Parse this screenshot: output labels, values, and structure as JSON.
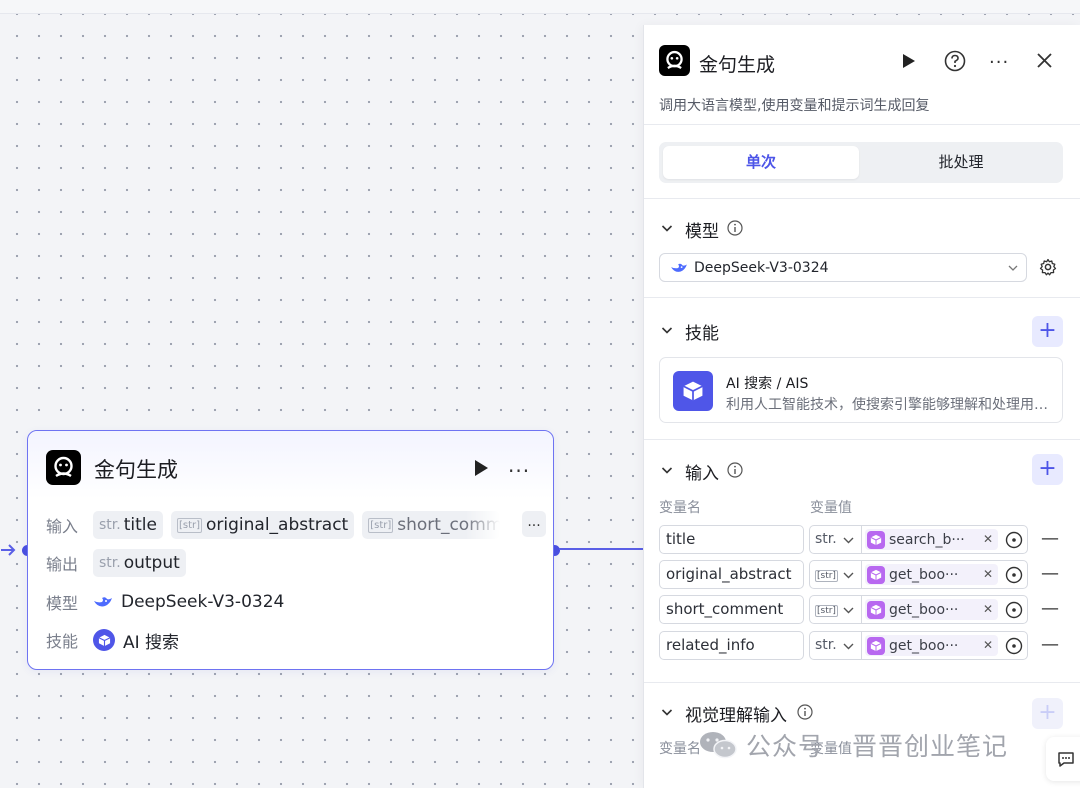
{
  "node": {
    "title": "金句生成",
    "input_label": "输入",
    "output_label": "输出",
    "model_label": "模型",
    "skill_label": "技能",
    "inputs": [
      {
        "type": "str.",
        "name": "title"
      },
      {
        "type": "[str]",
        "name": "original_abstract"
      },
      {
        "type": "[str]",
        "name": "short_comment"
      }
    ],
    "output": {
      "type": "str.",
      "name": "output"
    },
    "model": "DeepSeek-V3-0324",
    "skill": "AI 搜索",
    "more": "..."
  },
  "panel": {
    "title": "金句生成",
    "description": "调用大语言模型,使用变量和提示词生成回复",
    "tabs": [
      "单次",
      "批处理"
    ],
    "model_section": {
      "title": "模型",
      "selected": "DeepSeek-V3-0324"
    },
    "skills_section": {
      "title": "技能",
      "card_name": "AI 搜索 / AIS",
      "card_desc": "利用人工智能技术，使搜索引擎能够理解和处理用户的查询"
    },
    "input_section": {
      "title": "输入",
      "col_name": "变量名",
      "col_value": "变量值",
      "rows": [
        {
          "name": "title",
          "type": "str.",
          "ref": "search_b···"
        },
        {
          "name": "original_abstract",
          "type": "[str]",
          "ref": "get_boo···"
        },
        {
          "name": "short_comment",
          "type": "[str]",
          "ref": "get_boo···"
        },
        {
          "name": "related_info",
          "type": "str.",
          "ref": "get_boo···"
        }
      ]
    },
    "visual_section": {
      "title": "视觉理解输入",
      "col_name": "变量名",
      "col_value": "变量值"
    }
  },
  "watermark": {
    "label": "公众号",
    "name": "晋晋创业笔记"
  },
  "colors": {
    "accent": "#4d55e8",
    "node_border": "#6e73f2",
    "ref_icon": "#b868f0"
  }
}
